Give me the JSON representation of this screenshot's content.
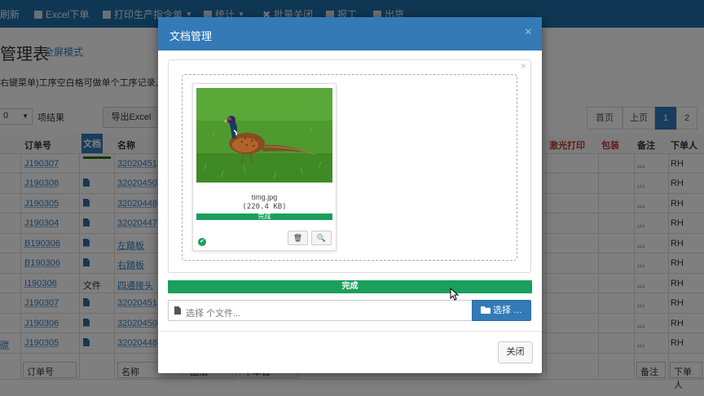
{
  "topbar": {
    "refresh": "刷新",
    "excel_order": "Excel下单",
    "print_order": "打印生产指令单",
    "stats": "统计",
    "batch_close": "批量关闭",
    "report": "报工",
    "shipping": "出货"
  },
  "page": {
    "title": "管理表",
    "subtitle": "全屏模式",
    "hint": "右键菜单)工序空白格可做单个工序记录,",
    "page_size": "0",
    "page_size_label": "项结果",
    "export_label": "导出Excel"
  },
  "pager": {
    "first": "首页",
    "prev": "上页",
    "p1": "1",
    "p2": "2"
  },
  "table": {
    "headers": {
      "order_no": "订单号",
      "doc": "文档",
      "name": "名称",
      "laser": "激光打印",
      "pack": "包装",
      "remark": "备注",
      "orderer": "下单人"
    },
    "rows": [
      {
        "order_no": "J190307",
        "doc": "",
        "name": "32020451",
        "orderer": "RH"
      },
      {
        "order_no": "J190306",
        "doc": "icon",
        "name": "32020450",
        "orderer": "RH"
      },
      {
        "order_no": "J190305",
        "doc": "icon",
        "name": "32020448",
        "orderer": "RH"
      },
      {
        "order_no": "J190304",
        "doc": "icon",
        "name": "32020447",
        "orderer": "RH"
      },
      {
        "order_no": "B190306",
        "doc": "icon",
        "name": "左踏板",
        "orderer": "RH"
      },
      {
        "order_no": "B190306",
        "doc": "icon",
        "name": "右踏板",
        "orderer": "RH"
      },
      {
        "order_no": "I190306",
        "doc": "文件",
        "name": "四通接头",
        "orderer": "RH"
      },
      {
        "order_no": "J190307",
        "doc": "icon",
        "name": "32020451",
        "orderer": "RH"
      },
      {
        "order_no": "J190306",
        "doc": "icon",
        "name": "32020450",
        "orderer": "RH"
      },
      {
        "order_no": "J190305",
        "doc": "icon",
        "name": "32020448",
        "orderer": "RH"
      }
    ],
    "remark_dots": "...",
    "row10_prefix": "碳",
    "filters": {
      "order_no": "订单号",
      "name": "名称",
      "p3": "图纸",
      "p4": "下单日",
      "remark": "备注",
      "orderer": "下单人"
    }
  },
  "modal": {
    "title": "文档管理",
    "close_x": "×",
    "zone_close": "×",
    "file": {
      "name": "timg.jpg",
      "size": "(220.4 KB)",
      "status": "完成",
      "progress": 1.0
    },
    "overall": {
      "label": "完成",
      "progress": 1.0
    },
    "caption": "选择 个文件...",
    "browse_label": "选择 …",
    "close_label": "关闭"
  },
  "colors": {
    "header_bg": "#337ab7",
    "success": "#1a9f5c",
    "topbar": "#1f6fa8"
  }
}
